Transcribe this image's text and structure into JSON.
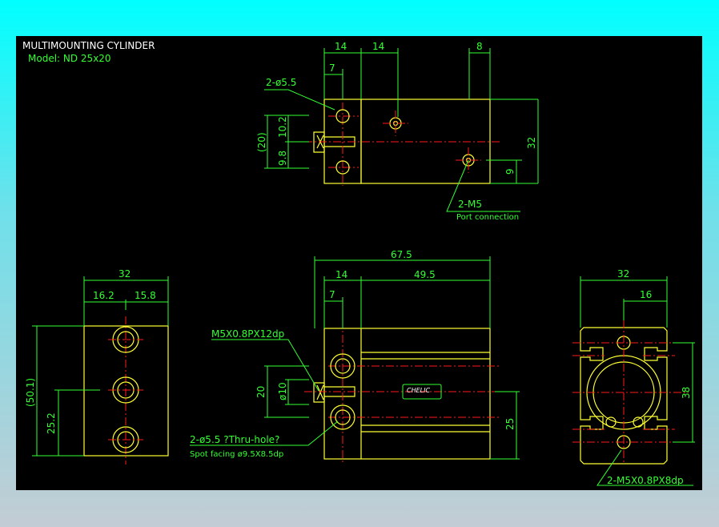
{
  "title": "MULTIMOUNTING CYLINDER",
  "model": "Model: ND 25x20",
  "colors": {
    "background": "#000000",
    "outline": "#ffff33",
    "centerline": "#ff1a1a",
    "dimension": "#33ff33",
    "title": "#ffffff"
  },
  "top_view": {
    "dims": [
      "14",
      "14",
      "8",
      "7",
      "(20)",
      "10.2",
      "9.8",
      "32",
      "9"
    ],
    "hole_note": "2-ø5.5",
    "port_note": "2-M5",
    "port_sub": "Port connection"
  },
  "side_view": {
    "dims": [
      "32",
      "16.2",
      "15.8",
      "(50.1)",
      "25.2"
    ]
  },
  "front_view": {
    "dims": [
      "67.5",
      "14",
      "49.5",
      "7",
      "20",
      "ø10",
      "25"
    ],
    "thread_note": "M5X0.8PX12dp",
    "hole_note": "2-ø5.5 ?Thru-hole?",
    "spot_note": "Spot facing ø9.5X8.5dp",
    "brand": "CHELIC"
  },
  "end_view": {
    "dims": [
      "32",
      "16",
      "38"
    ],
    "thread_note": "2-M5X0.8PX8dp"
  }
}
